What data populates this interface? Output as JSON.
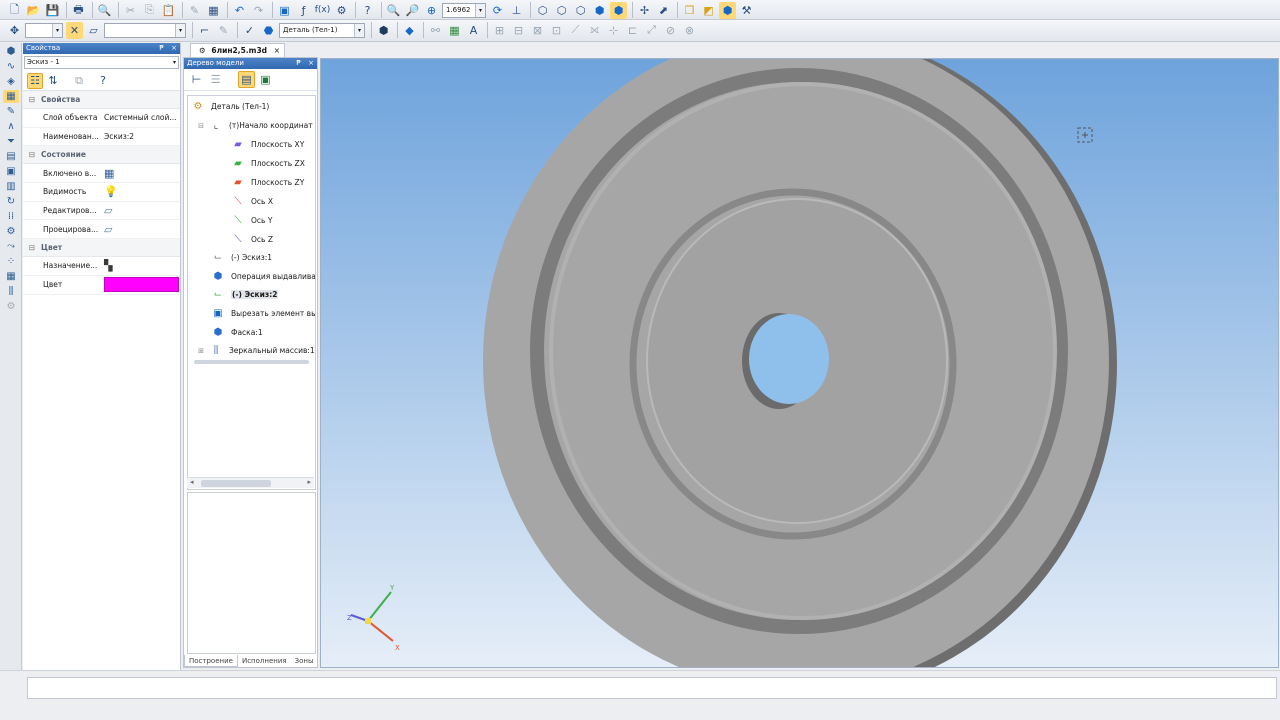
{
  "toolbar": {
    "zoom_value": "1.6962",
    "part_combo": "Деталь (Тел-1)"
  },
  "document": {
    "tab_title": "6лин2,5.m3d",
    "close": "×"
  },
  "properties": {
    "title": "Свойства",
    "pin": "₱",
    "close": "×",
    "object_select": "Эскиз - 1",
    "sections": {
      "props": "Свойства",
      "state": "Состояние",
      "color": "Цвет"
    },
    "rows": [
      {
        "key": "Слой объекта",
        "value": "Системный слой..."
      },
      {
        "key": "Наименован...",
        "value": "Эскиз:2"
      },
      {
        "key": "Включено в...",
        "value": ""
      },
      {
        "key": "Видимость",
        "value": ""
      },
      {
        "key": "Редактиров...",
        "value": ""
      },
      {
        "key": "Проецирова...",
        "value": ""
      },
      {
        "key": "Назначение...",
        "value": ""
      },
      {
        "key": "Цвет",
        "value": ""
      }
    ],
    "color_value": "#ff00ff"
  },
  "tree": {
    "title": "Дерево модели",
    "pin": "₱",
    "close": "×",
    "nodes": [
      {
        "label": "Деталь (Тел-1)",
        "icon": "part-icon"
      },
      {
        "label": "(т)Начало координат",
        "icon": "origin-icon"
      },
      {
        "label": "Плоскость XY",
        "icon": "plane-xy-icon"
      },
      {
        "label": "Плоскость ZX",
        "icon": "plane-zx-icon"
      },
      {
        "label": "Плоскость ZY",
        "icon": "plane-zy-icon"
      },
      {
        "label": "Ось X",
        "icon": "axis-x-icon"
      },
      {
        "label": "Ось Y",
        "icon": "axis-y-icon"
      },
      {
        "label": "Ось Z",
        "icon": "axis-z-icon"
      },
      {
        "label": "(-) Эскиз:1",
        "icon": "sketch-icon"
      },
      {
        "label": "Операция выдавливания",
        "icon": "extrude-icon"
      },
      {
        "label": "(-) Эскиз:2",
        "icon": "sketch-icon"
      },
      {
        "label": "Вырезать элемент выд",
        "icon": "cut-icon"
      },
      {
        "label": "Фаска:1",
        "icon": "chamfer-icon"
      },
      {
        "label": "Зеркальный массив:1",
        "icon": "mirror-icon"
      }
    ],
    "tabs": [
      "Построение",
      "Исполнения",
      "Зоны"
    ]
  },
  "viewport": {
    "axis_x": "X",
    "axis_y": "Y",
    "axis_z": "Z"
  },
  "colors": {
    "viewport_sky_top": "#6ea3dc",
    "viewport_sky_bottom": "#e6eef8",
    "part_face": "#a6a6a6",
    "part_edge": "#6e6e6e",
    "title_bar": "#2f68b0"
  }
}
